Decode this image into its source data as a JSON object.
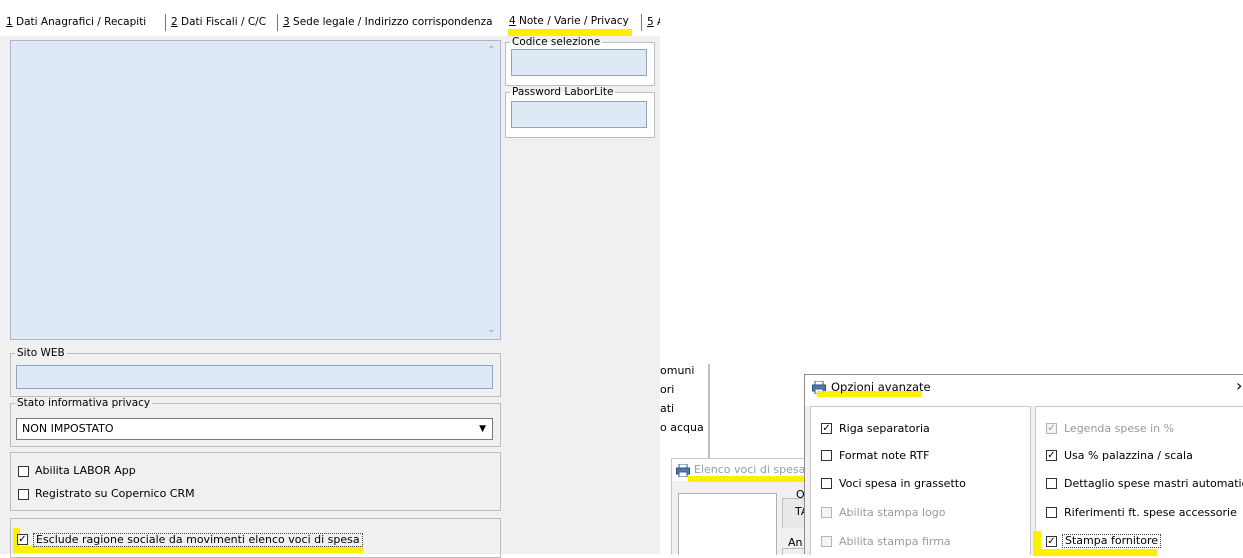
{
  "tabs": [
    {
      "num": "1",
      "label": " Dati Anagrafici / Recapiti"
    },
    {
      "num": "2",
      "label": " Dati Fiscali / C/C"
    },
    {
      "num": "3",
      "label": " Sede legale / Indirizzo corrispondenza"
    },
    {
      "num": "4",
      "label": " Note / Varie / Privacy"
    },
    {
      "num": "5",
      "label": " A"
    }
  ],
  "side_groups": {
    "codice_selezione": "Codice selezione",
    "password_laborlite": "Password LaborLite"
  },
  "sito_web": {
    "legend": "Sito WEB",
    "value": ""
  },
  "privacy": {
    "legend": "Stato informativa privacy",
    "value": "NON IMPOSTATO"
  },
  "apps": {
    "abilita_labor_app": {
      "label": "Abilita LABOR App",
      "checked": false
    },
    "copernico_crm": {
      "label": "Registrato su Copernico CRM",
      "checked": false
    }
  },
  "esclude": {
    "label": "Esclude ragione sociale da movimenti elenco voci di spesa",
    "checked": true
  },
  "fragments": [
    "omuni",
    "ori",
    "ati",
    "o acqua"
  ],
  "elenco": {
    "title": "Elenco voci di spesa",
    "frag1": "Or",
    "frag2": "TA",
    "frag3": "An"
  },
  "opzioni": {
    "title": "Opzioni avanzate",
    "close": "›",
    "left": [
      {
        "label": "Riga separatoria",
        "checked": true,
        "disabled": false
      },
      {
        "label": "Format note RTF",
        "checked": false,
        "disabled": false
      },
      {
        "label": "Voci spesa in grassetto",
        "checked": false,
        "disabled": false
      },
      {
        "label": "Abilita stampa logo",
        "checked": false,
        "disabled": true
      },
      {
        "label": "Abilita stampa firma",
        "checked": false,
        "disabled": true
      }
    ],
    "right": [
      {
        "label": "Legenda spese in %",
        "checked": true,
        "disabled": true
      },
      {
        "label": "Usa % palazzina / scala",
        "checked": true,
        "disabled": false
      },
      {
        "label": "Dettaglio spese mastri automatici",
        "checked": false,
        "disabled": false
      },
      {
        "label": "Riferimenti ft. spese accessorie",
        "checked": false,
        "disabled": false
      },
      {
        "label": "Stampa fornitore",
        "checked": true,
        "disabled": false
      }
    ]
  },
  "colors": {
    "highlight": "#fbf000",
    "field_bg": "#dfe9f5",
    "panel_bg": "#f0f0f0"
  }
}
